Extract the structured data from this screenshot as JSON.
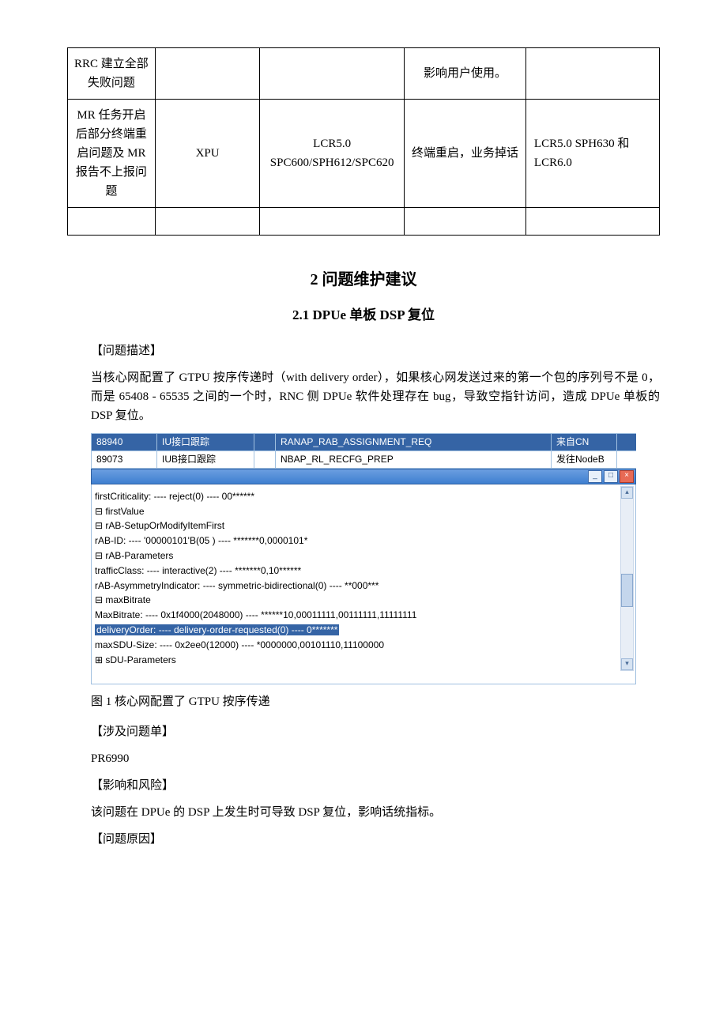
{
  "table": {
    "rows": [
      {
        "c1": "RRC 建立全部失败问题",
        "c2": "",
        "c3": "",
        "c4": "影响用户使用。",
        "c5": ""
      },
      {
        "c1": "MR 任务开启后部分终端重启问题及 MR报告不上报问题",
        "c2": "XPU",
        "c3": "LCR5.0 SPC600/SPH612/SPC620",
        "c4": "终端重启，业务掉话",
        "c5": "LCR5.0 SPH630 和 LCR6.0"
      }
    ]
  },
  "headings": {
    "sec2": "2 问题维护建议",
    "sub21": "2.1 DPUe 单板 DSP 复位"
  },
  "labels": {
    "desc": "【问题描述】",
    "related": "【涉及问题单】",
    "impact": "【影响和风险】",
    "cause": "【问题原因】"
  },
  "body": {
    "desc1": "当核心网配置了 GTPU 按序传递时（with delivery order），如果核心网发送过来的第一个包的序列号不是 0，而是 65408 - 65535 之间的一个时，RNC 侧 DPUe 软件处理存在 bug，导致空指针访问，造成 DPUe 单板的 DSP 复位。",
    "pr": "PR6990",
    "impact1": "该问题在 DPUe 的 DSP 上发生时可导致 DSP 复位，影响话统指标。"
  },
  "trace": {
    "row1": {
      "id": "88940",
      "if": "IU接口跟踪",
      "msg": "RANAP_RAB_ASSIGNMENT_REQ",
      "src": "来自CN"
    },
    "row2": {
      "id": "89073",
      "if": "IUB接口跟踪",
      "msg": "NBAP_RL_RECFG_PREP",
      "src": "发往NodeB"
    }
  },
  "tree": {
    "l1": "firstCriticality: ---- reject(0) ---- 00******",
    "l2": "firstValue",
    "l3": "rAB-SetupOrModifyItemFirst",
    "l4": "rAB-ID: ---- '00000101'B(05 ) ---- *******0,0000101*",
    "l5": "rAB-Parameters",
    "l6": "trafficClass: ---- interactive(2) ---- *******0,10******",
    "l7": "rAB-AsymmetryIndicator: ---- symmetric-bidirectional(0) ---- **000***",
    "l8": "maxBitrate",
    "l9": "MaxBitrate: ---- 0x1f4000(2048000) ---- ******10,00011111,00111111,11111111",
    "l10": "deliveryOrder: ---- delivery-order-requested(0) ---- 0*******",
    "l11": "maxSDU-Size: ---- 0x2ee0(12000) ---- *0000000,00101110,11100000",
    "l12": "sDU-Parameters"
  },
  "fig_caption": "图 1 核心网配置了 GTPU 按序传递"
}
